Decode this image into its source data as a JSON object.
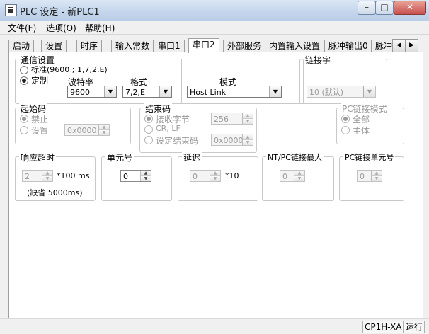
{
  "window": {
    "title": "PLC 设定 - 新PLC1",
    "min_label": "–",
    "max_label": "□",
    "close_label": "✕"
  },
  "menu": {
    "items": [
      "文件(F)",
      "选项(O)",
      "帮助(H)"
    ]
  },
  "tabs": {
    "items": [
      "启动",
      "设置",
      "时序",
      "输入常数",
      "串口1",
      "串口2",
      "外部服务",
      "内置输入设置",
      "脉冲输出0",
      "脉冲"
    ],
    "active": "串口2",
    "scroll_left": "◀",
    "scroll_right": "▶"
  },
  "comm": {
    "group_label": "通信设置",
    "standard_label": "标准(9600 ; 1,7,2,E)",
    "custom_label": "定制",
    "baud_label": "波特率",
    "baud_value": "9600",
    "format_label": "格式",
    "format_value": "7,2,E",
    "mode_label": "模式",
    "mode_value": "Host Link"
  },
  "link_word": {
    "label": "链接字",
    "value": "10 (默认)"
  },
  "start_code": {
    "label": "起始码",
    "disable_label": "禁止",
    "set_label": "设置",
    "value": "0x0000"
  },
  "end_code": {
    "label": "结束码",
    "recv_bytes_label": "接收字节",
    "recv_bytes_value": "256",
    "crlf_label": "CR, LF",
    "set_end_label": "设定结束码",
    "end_value": "0x0000"
  },
  "pc_link_mode": {
    "label": "PC链接模式",
    "all_label": "全部",
    "master_label": "主体"
  },
  "response_timeout": {
    "label": "响应超时",
    "value": "2",
    "unit": "*100 ms",
    "default_note": "(缺省 5000ms)"
  },
  "unit_no": {
    "label": "单元号",
    "value": "0"
  },
  "delay": {
    "label": "延迟",
    "value": "0",
    "unit": "*10"
  },
  "nt_pc_link_max": {
    "label": "NT/PC链接最大",
    "value": "0"
  },
  "pc_link_unit": {
    "label": "PC链接单元号",
    "value": "0"
  },
  "status": {
    "model": "CP1H-XA",
    "state": "运行"
  },
  "icons": {
    "combo_arrow": "▼",
    "spin_up": "▲",
    "spin_down": "▼"
  }
}
